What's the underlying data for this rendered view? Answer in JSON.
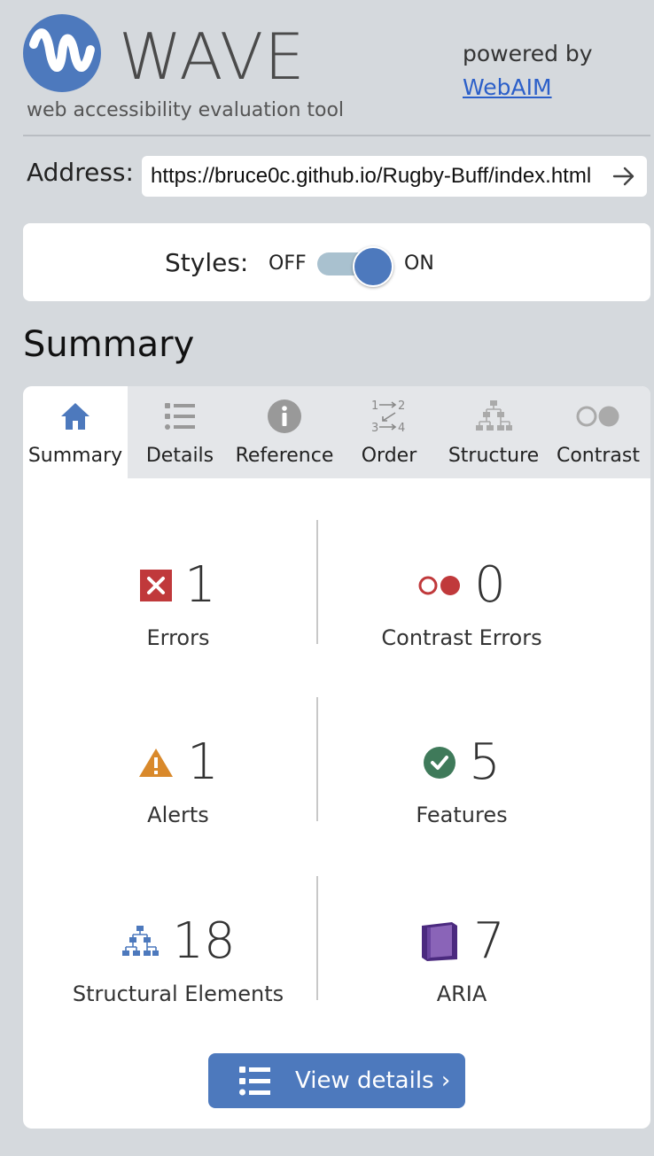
{
  "header": {
    "title": "WAVE",
    "tagline": "web accessibility evaluation tool",
    "powered_by": "powered by",
    "brand_link": "WebAIM"
  },
  "address": {
    "label": "Address:",
    "value": "https://bruce0c.github.io/Rugby-Buff/index.html"
  },
  "styles": {
    "label": "Styles:",
    "off": "OFF",
    "on": "ON",
    "state": "on"
  },
  "summary_heading": "Summary",
  "tabs": [
    {
      "label": "Summary",
      "icon": "home-icon",
      "active": true
    },
    {
      "label": "Details",
      "icon": "list-icon",
      "active": false
    },
    {
      "label": "Reference",
      "icon": "info-icon",
      "active": false
    },
    {
      "label": "Order",
      "icon": "order-icon",
      "active": false
    },
    {
      "label": "Structure",
      "icon": "structure-icon",
      "active": false
    },
    {
      "label": "Contrast",
      "icon": "contrast-icon",
      "active": false
    }
  ],
  "stats": {
    "errors": {
      "count": "1",
      "label": "Errors"
    },
    "contrast_errors": {
      "count": "0",
      "label": "Contrast Errors"
    },
    "alerts": {
      "count": "1",
      "label": "Alerts"
    },
    "features": {
      "count": "5",
      "label": "Features"
    },
    "structural": {
      "count": "18",
      "label": "Structural Elements"
    },
    "aria": {
      "count": "7",
      "label": "ARIA"
    }
  },
  "view_details_label": "View details ›",
  "colors": {
    "accent": "#4d79bd",
    "error": "#c0393b",
    "alert": "#d9892b",
    "feature": "#3f7a5a",
    "aria": "#4b2a7f"
  }
}
